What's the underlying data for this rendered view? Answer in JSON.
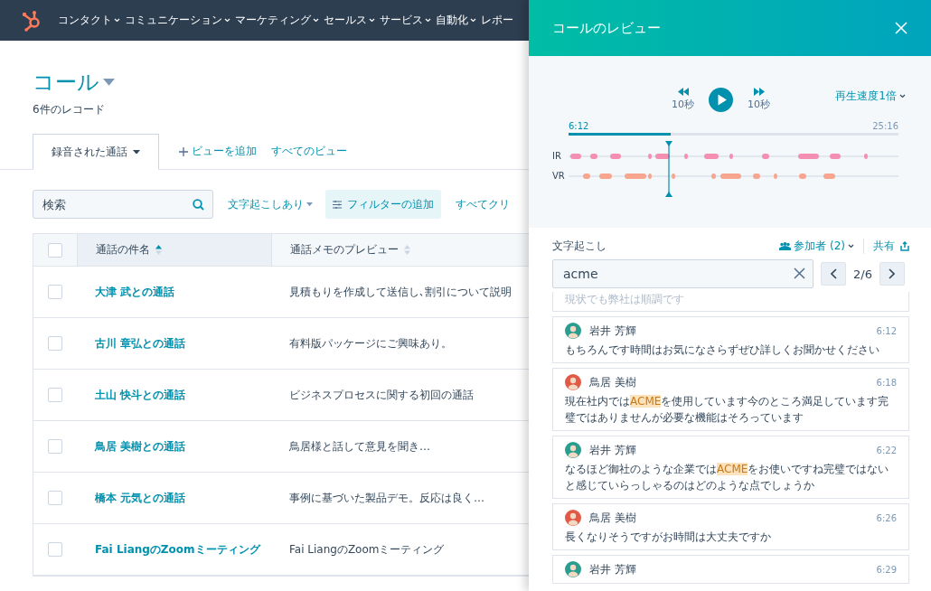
{
  "nav": {
    "items": [
      {
        "label": "コンタクト"
      },
      {
        "label": "コミュニケーション"
      },
      {
        "label": "マーケティング"
      },
      {
        "label": "セールス"
      },
      {
        "label": "サービス"
      },
      {
        "label": "自動化"
      },
      {
        "label": "レポー"
      }
    ]
  },
  "page": {
    "title": "コール",
    "subtitle": "6件のレコード"
  },
  "view_tabs": [
    {
      "label": "録音された通話",
      "selected": true
    }
  ],
  "view_actions": {
    "add_view": "ビューを追加",
    "all_views": "すべてのビュー"
  },
  "filters": {
    "search_placeholder": "検索",
    "transcript_filter": "文字起こしあり",
    "add_filter": "フィルターの追加",
    "clear_all": "すべてクリ"
  },
  "table": {
    "select_all_checked": false,
    "columns": [
      {
        "label": "通話の件名",
        "sorted": true
      },
      {
        "label": "通話メモのプレビュー",
        "sorted": false
      }
    ],
    "rows": [
      {
        "checked": false,
        "subject": "大津 武との通話",
        "preview": "見積もりを作成して送信し､割引について説明"
      },
      {
        "checked": false,
        "subject": "古川 章弘との通話",
        "preview": "有料版パッケージにご興味あり。"
      },
      {
        "checked": false,
        "subject": "土山 快斗との通話",
        "preview": "ビジネスプロセスに関する初回の通話"
      },
      {
        "checked": false,
        "subject": "鳥居 美樹との通話",
        "preview": "鳥居様と話して意見を聞き…"
      },
      {
        "checked": false,
        "subject": "橋本 元気との通話",
        "preview": "事例に基づいた製品デモ。反応は良く…"
      },
      {
        "checked": false,
        "subject": "Fai LiangのZoomミーティング",
        "preview": "Fai LiangのZoomミーティング"
      }
    ]
  },
  "panel": {
    "title": "コールのレビュー",
    "player": {
      "rewind": "10秒",
      "forward": "10秒",
      "speed": "再生速度1倍",
      "current": "6:12",
      "total": "25:16",
      "level": 0.31,
      "tracks": [
        {
          "label": "IR",
          "color": "#f48fb1"
        },
        {
          "label": "VR",
          "color": "#f8a58f"
        }
      ]
    },
    "transcript": {
      "title": "文字起こし",
      "participants": "参加者 (2)",
      "share": "共有",
      "query": "acme",
      "position": "2/6",
      "partial": "現状でも弊社は順調です",
      "entries": [
        {
          "speaker": "岩井 芳輝",
          "time": "6:12",
          "text": "もちろんです時間はお気になさらずぜひ詳しくお聞かせください",
          "color": "#2a9d8f"
        },
        {
          "speaker": "鳥居 美樹",
          "time": "6:18",
          "text": "現在社内では**ACME**を使用しています今のところ満足しています完璧ではありませんが必要な機能はそろっています",
          "color": "#e05a47"
        },
        {
          "speaker": "岩井 芳輝",
          "time": "6:22",
          "text": "なるほど御社のような企業では**ACME**をお使いですね完璧ではないと感じていらっしゃるのはどのような点でしょうか",
          "color": "#2a9d8f"
        },
        {
          "speaker": "鳥居 美樹",
          "time": "6:26",
          "text": "長くなりそうですがお時間は大丈夫ですか",
          "color": "#e05a47"
        },
        {
          "speaker": "岩井 芳輝",
          "time": "6:29",
          "color": "#2a9d8f"
        }
      ]
    }
  }
}
